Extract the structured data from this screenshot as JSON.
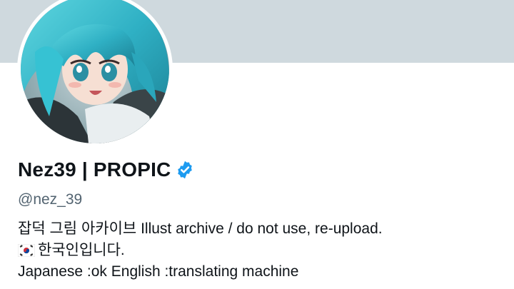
{
  "profile": {
    "display_name": "Nez39 | PROPIC",
    "handle": "@nez_39",
    "verified_icon": "verified-badge-icon",
    "bio": {
      "line1": "잡덕 그림 아카이브 Illust archive / do not use, re-upload.",
      "line2_flag_icon": "korea-flag-icon",
      "line2_text": "한국인입니다.",
      "line3": "Japanese :ok English :translating machine"
    }
  },
  "colors": {
    "banner": "#cfd9de",
    "verified": "#1d9bf0",
    "handle": "#536471",
    "text": "#0f1419"
  }
}
